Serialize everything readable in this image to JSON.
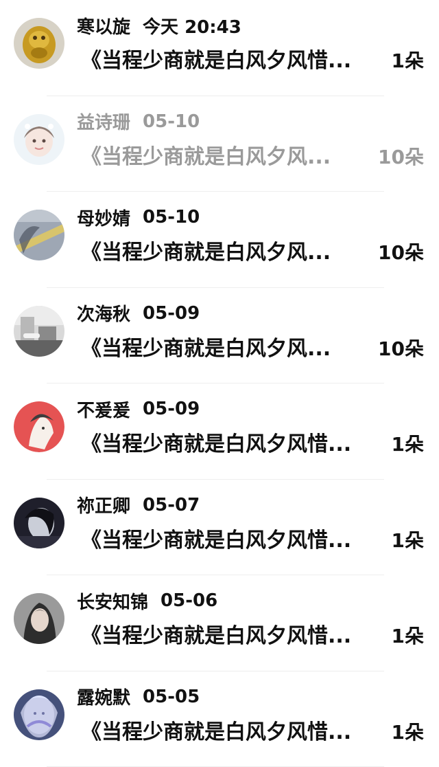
{
  "gift_list": [
    {
      "name": "寒以旋",
      "time": "今天 20:43",
      "title": "《当程少商就是白风夕风惜...",
      "count": "1朵",
      "avatar": "golden-monkey-figurine-avatar",
      "faded": false
    },
    {
      "name": "益诗珊",
      "time": "05-10",
      "title": "《当程少商就是白风夕风...",
      "count": "10朵",
      "avatar": "cute-girl-filter-avatar",
      "faded": true
    },
    {
      "name": "母妙婧",
      "time": "05-10",
      "title": "《当程少商就是白风夕风...",
      "count": "10朵",
      "avatar": "road-shadow-avatar",
      "faded": false
    },
    {
      "name": "次海秋",
      "time": "05-09",
      "title": "《当程少商就是白风夕风...",
      "count": "10朵",
      "avatar": "room-photo-avatar",
      "faded": false
    },
    {
      "name": "不爰爰",
      "time": "05-09",
      "title": "《当程少商就是白风夕风惜...",
      "count": "1朵",
      "avatar": "red-illustration-avatar",
      "faded": false
    },
    {
      "name": "祢正卿",
      "time": "05-07",
      "title": "《当程少商就是白风夕风惜...",
      "count": "1朵",
      "avatar": "dark-portrait-avatar",
      "faded": false
    },
    {
      "name": "长安知锦",
      "time": "05-06",
      "title": "《当程少商就是白风夕风惜...",
      "count": "1朵",
      "avatar": "girl-portrait-avatar",
      "faded": false
    },
    {
      "name": "露婉默",
      "time": "05-05",
      "title": "《当程少商就是白风夕风惜...",
      "count": "1朵",
      "avatar": "fantasy-character-avatar",
      "faded": false
    }
  ],
  "colors": {
    "text": "#111111",
    "faded_text": "#9a9a9a",
    "divider": "#eeeeee"
  }
}
